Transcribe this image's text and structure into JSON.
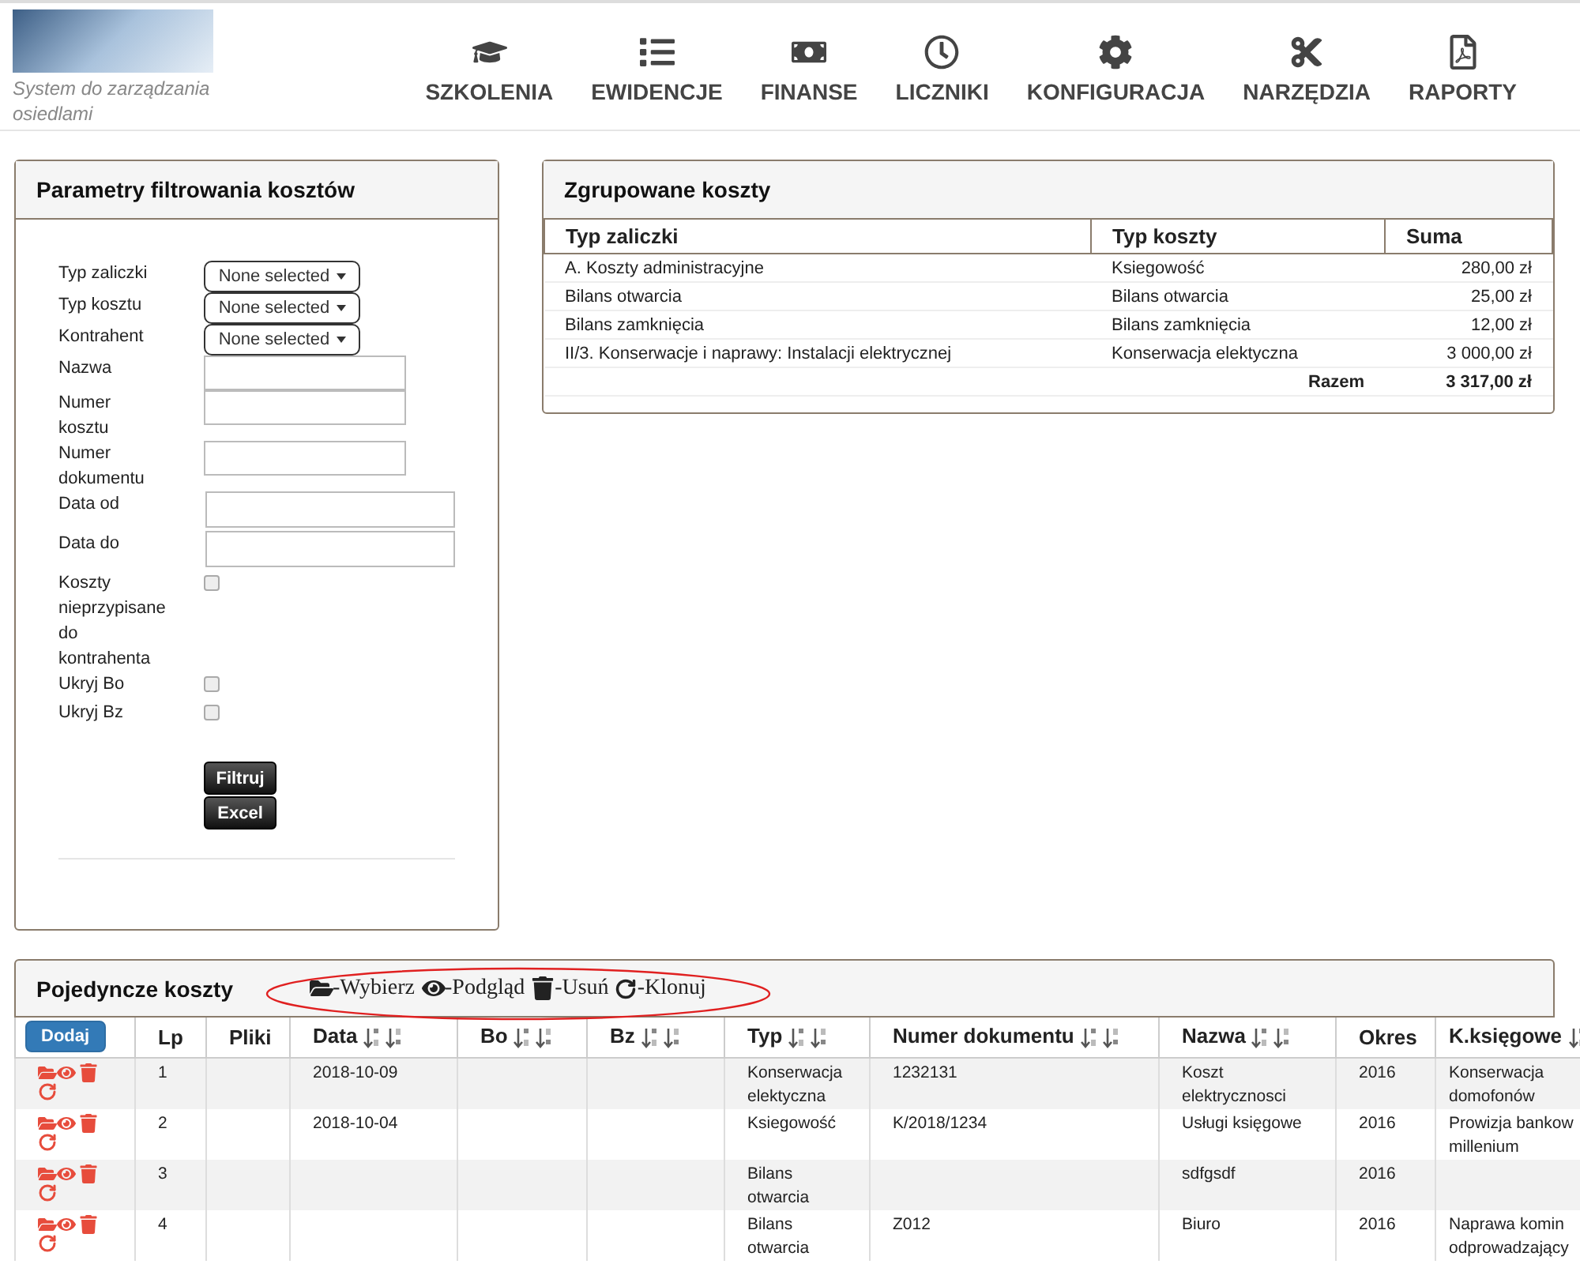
{
  "header": {
    "logo_subtitle": "System do zarządzania osiedlami",
    "nav": [
      {
        "label": "SZKOLENIA"
      },
      {
        "label": "EWIDENCJE"
      },
      {
        "label": "FINANSE"
      },
      {
        "label": "LICZNIKI"
      },
      {
        "label": "KONFIGURACJA"
      },
      {
        "label": "NARZĘDZIA"
      },
      {
        "label": "RAPORTY"
      }
    ]
  },
  "filter_panel": {
    "title": "Parametry filtrowania kosztów",
    "fields": [
      {
        "kind": "dropdown",
        "label": "Typ zaliczki",
        "value": "None selected"
      },
      {
        "kind": "dropdown",
        "label": "Typ kosztu",
        "value": "None selected"
      },
      {
        "kind": "dropdown",
        "label": "Kontrahent",
        "value": "None selected"
      },
      {
        "kind": "text",
        "label": "Nazwa"
      },
      {
        "kind": "text",
        "label": "Numer kosztu"
      },
      {
        "kind": "text",
        "label": "Numer dokumentu"
      },
      {
        "kind": "date",
        "label": "Data od"
      },
      {
        "kind": "date",
        "label": "Data do"
      },
      {
        "kind": "checkbox",
        "label": "Koszty nieprzypisane do kontrahenta",
        "checked": false
      },
      {
        "kind": "checkbox",
        "label": "Ukryj Bo",
        "checked": false
      },
      {
        "kind": "checkbox",
        "label": "Ukryj Bz",
        "checked": false
      }
    ],
    "buttons": [
      "Filtruj",
      "Excel"
    ]
  },
  "grouped_panel": {
    "title": "Zgrupowane koszty",
    "columns": [
      "Typ zaliczki",
      "Typ koszty",
      "Suma"
    ],
    "rows": [
      {
        "typ_zaliczki": "A. Koszty administracyjne",
        "typ_koszty": "Ksiegowość",
        "suma": "280,00 zł"
      },
      {
        "typ_zaliczki": "Bilans otwarcia",
        "typ_koszty": "Bilans otwarcia",
        "suma": "25,00 zł"
      },
      {
        "typ_zaliczki": "Bilans zamknięcia",
        "typ_koszty": "Bilans zamknięcia",
        "suma": "12,00 zł"
      },
      {
        "typ_zaliczki": "II/3. Konserwacje i naprawy: Instalacji elektrycznej",
        "typ_koszty": "Konserwacja elektyczna",
        "suma": "3 000,00 zł"
      }
    ],
    "total": {
      "label": "Razem",
      "value": "3 317,00 zł"
    }
  },
  "costs_panel": {
    "title": "Pojedyncze koszty",
    "legend": [
      "-Wybierz",
      "-Podgląd",
      "-Usuń",
      "-Klonuj"
    ],
    "add_button": "Dodaj",
    "columns": [
      {
        "label": "Lp",
        "sortable": false
      },
      {
        "label": "Pliki",
        "sortable": false
      },
      {
        "label": "Data",
        "sortable": true
      },
      {
        "label": "Bo",
        "sortable": true
      },
      {
        "label": "Bz",
        "sortable": true
      },
      {
        "label": "Typ",
        "sortable": true
      },
      {
        "label": "Numer dokumentu",
        "sortable": true
      },
      {
        "label": "Nazwa",
        "sortable": true
      },
      {
        "label": "Okres",
        "sortable": false
      },
      {
        "label": "K.księgowe",
        "sortable": true
      }
    ],
    "rows": [
      {
        "cells": [
          "1",
          "",
          "2018-10-09",
          "",
          "",
          "Konserwacja elektyczna",
          "1232131",
          "Koszt elektrycznosci",
          "2016",
          "Konserwacja domofonów"
        ]
      },
      {
        "cells": [
          "2",
          "",
          "2018-10-04",
          "",
          "",
          "Ksiegowość",
          "K/2018/1234",
          "Usługi księgowe",
          "2016",
          "Prowizja bankow millenium"
        ]
      },
      {
        "cells": [
          "3",
          "",
          "",
          "",
          "",
          "Bilans otwarcia",
          "",
          "sdfgsdf",
          "2016",
          ""
        ]
      },
      {
        "cells": [
          "4",
          "",
          "",
          "",
          "",
          "Bilans otwarcia",
          "Z012",
          "Biuro",
          "2016",
          "Naprawa komin odprowadzający"
        ]
      }
    ]
  }
}
